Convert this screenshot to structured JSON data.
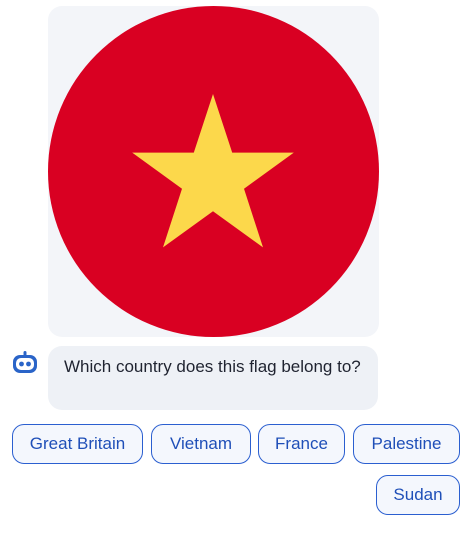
{
  "flag": {
    "icon": "vietnam-flag-icon",
    "colors": {
      "field": "#d90022",
      "star": "#fcd84b",
      "card": "#f3f5f9"
    }
  },
  "bot": {
    "icon": "robot-avatar-icon",
    "colors": {
      "body": "#2a64c8",
      "face": "#ffffff"
    }
  },
  "message": {
    "text": "Which country does this flag belong to?"
  },
  "answers": [
    {
      "label": "Great Britain"
    },
    {
      "label": "Vietnam"
    },
    {
      "label": "France"
    },
    {
      "label": "Palestine"
    },
    {
      "label": "Sudan"
    }
  ],
  "theme": {
    "chip_border": "#2b5fd0",
    "chip_text": "#1f4fb8",
    "bubble_bg": "#eef1f6"
  }
}
